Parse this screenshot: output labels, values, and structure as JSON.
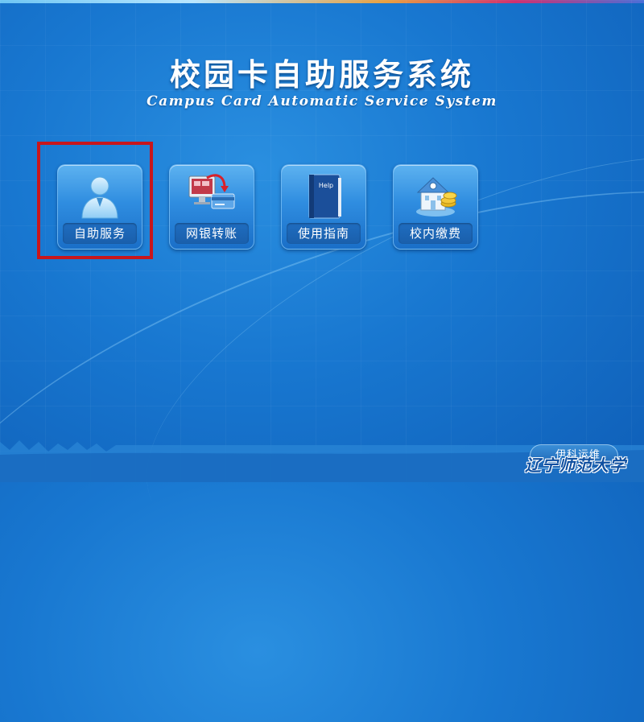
{
  "header": {
    "title_cn": "校园卡自助服务系统",
    "title_en": "Campus Card Automatic Service System"
  },
  "menu": {
    "items": [
      {
        "label": "自助服务",
        "icon": "user-icon",
        "selected": true
      },
      {
        "label": "网银转账",
        "icon": "bank-transfer-icon",
        "selected": false
      },
      {
        "label": "使用指南",
        "icon": "help-book-icon",
        "selected": false
      },
      {
        "label": "校内缴费",
        "icon": "school-payment-icon",
        "selected": false
      }
    ],
    "help_book_text": "Help"
  },
  "footer": {
    "badge_text": "伊科运维",
    "school_name": "辽宁师范大学"
  },
  "colors": {
    "background": "#1877d0",
    "highlight_border": "#c8161c",
    "tile": "#2f8de0",
    "label_bar": "#1a5fab"
  }
}
